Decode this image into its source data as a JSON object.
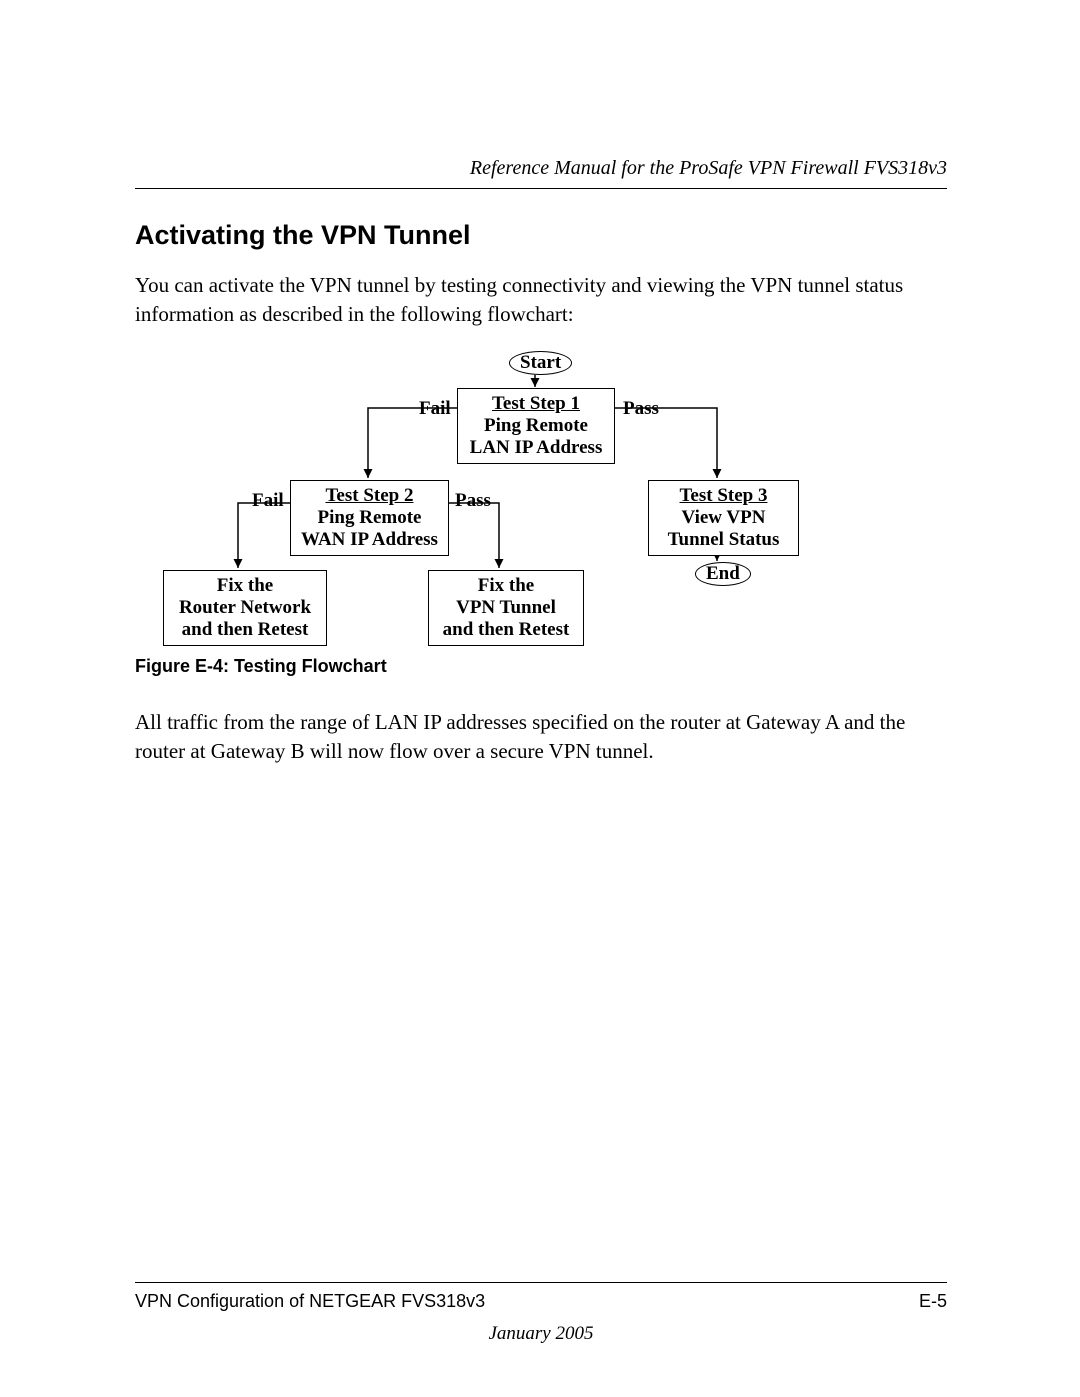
{
  "header": {
    "running_title": "Reference Manual for the ProSafe VPN Firewall FVS318v3"
  },
  "section": {
    "heading": "Activating the VPN Tunnel",
    "intro": "You can activate the VPN tunnel by testing connectivity and viewing the VPN tunnel status information as described in the following flowchart:",
    "after": "All traffic from the range of LAN IP addresses specified on the router at Gateway A and the router at Gateway B will now flow over a secure VPN tunnel."
  },
  "figure": {
    "caption": "Figure E-4:  Testing Flowchart"
  },
  "flow": {
    "start": "Start",
    "end": "End",
    "fail": "Fail",
    "pass": "Pass",
    "step1_title": "Test Step 1",
    "step1_line2": "Ping Remote",
    "step1_line3": "LAN IP Address",
    "step2_title": "Test Step 2",
    "step2_line2": "Ping Remote",
    "step2_line3": "WAN IP Address",
    "step3_title": "Test Step 3",
    "step3_line2": "View VPN",
    "step3_line3": "Tunnel Status",
    "fix_router_l1": "Fix the",
    "fix_router_l2": "Router Network",
    "fix_router_l3": "and then Retest",
    "fix_vpn_l1": "Fix the",
    "fix_vpn_l2": "VPN Tunnel",
    "fix_vpn_l3": "and then Retest"
  },
  "footer": {
    "left": "VPN Configuration of NETGEAR FVS318v3",
    "right": "E-5",
    "date": "January 2005"
  },
  "chart_data": {
    "type": "flowchart",
    "nodes": [
      {
        "id": "start",
        "kind": "terminator",
        "label": "Start"
      },
      {
        "id": "step1",
        "kind": "process",
        "label": "Test Step 1 — Ping Remote LAN IP Address"
      },
      {
        "id": "step2",
        "kind": "process",
        "label": "Test Step 2 — Ping Remote WAN IP Address"
      },
      {
        "id": "step3",
        "kind": "process",
        "label": "Test Step 3 — View VPN Tunnel Status"
      },
      {
        "id": "fix_router",
        "kind": "process",
        "label": "Fix the Router Network and then Retest"
      },
      {
        "id": "fix_vpn",
        "kind": "process",
        "label": "Fix the VPN Tunnel and then Retest"
      },
      {
        "id": "end",
        "kind": "terminator",
        "label": "End"
      }
    ],
    "edges": [
      {
        "from": "start",
        "to": "step1",
        "label": ""
      },
      {
        "from": "step1",
        "to": "step3",
        "label": "Pass"
      },
      {
        "from": "step1",
        "to": "step2",
        "label": "Fail"
      },
      {
        "from": "step2",
        "to": "fix_vpn",
        "label": "Pass"
      },
      {
        "from": "step2",
        "to": "fix_router",
        "label": "Fail"
      },
      {
        "from": "step3",
        "to": "end",
        "label": ""
      }
    ]
  }
}
